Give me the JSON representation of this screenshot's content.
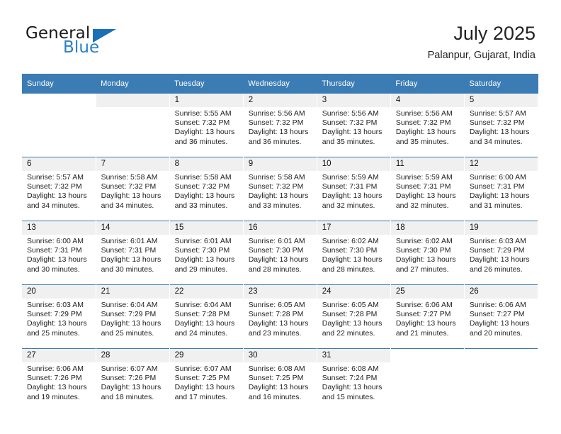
{
  "brand": {
    "word1": "General",
    "word2": "Blue",
    "triangle_color": "#1b6fb5",
    "blue_color": "#2980c4"
  },
  "header": {
    "title": "July 2025",
    "location": "Palanpur, Gujarat, India"
  },
  "theme": {
    "header_bg": "#3b7cb5",
    "daynum_bg": "#f0f0f0",
    "rule_color": "#3b7cb5"
  },
  "weekday_headers": [
    "Sunday",
    "Monday",
    "Tuesday",
    "Wednesday",
    "Thursday",
    "Friday",
    "Saturday"
  ],
  "labels": {
    "sunrise": "Sunrise:",
    "sunset": "Sunset:",
    "daylight": "Daylight:"
  },
  "weeks": [
    [
      {
        "day": "",
        "sunrise": "",
        "sunset": "",
        "daylight": "",
        "blank": true
      },
      {
        "day": "",
        "sunrise": "",
        "sunset": "",
        "daylight": "",
        "empty": true
      },
      {
        "day": "1",
        "sunrise": "Sunrise: 5:55 AM",
        "sunset": "Sunset: 7:32 PM",
        "daylight": "Daylight: 13 hours and 36 minutes."
      },
      {
        "day": "2",
        "sunrise": "Sunrise: 5:56 AM",
        "sunset": "Sunset: 7:32 PM",
        "daylight": "Daylight: 13 hours and 36 minutes."
      },
      {
        "day": "3",
        "sunrise": "Sunrise: 5:56 AM",
        "sunset": "Sunset: 7:32 PM",
        "daylight": "Daylight: 13 hours and 35 minutes."
      },
      {
        "day": "4",
        "sunrise": "Sunrise: 5:56 AM",
        "sunset": "Sunset: 7:32 PM",
        "daylight": "Daylight: 13 hours and 35 minutes."
      },
      {
        "day": "5",
        "sunrise": "Sunrise: 5:57 AM",
        "sunset": "Sunset: 7:32 PM",
        "daylight": "Daylight: 13 hours and 34 minutes."
      }
    ],
    [
      {
        "day": "6",
        "sunrise": "Sunrise: 5:57 AM",
        "sunset": "Sunset: 7:32 PM",
        "daylight": "Daylight: 13 hours and 34 minutes."
      },
      {
        "day": "7",
        "sunrise": "Sunrise: 5:58 AM",
        "sunset": "Sunset: 7:32 PM",
        "daylight": "Daylight: 13 hours and 34 minutes."
      },
      {
        "day": "8",
        "sunrise": "Sunrise: 5:58 AM",
        "sunset": "Sunset: 7:32 PM",
        "daylight": "Daylight: 13 hours and 33 minutes."
      },
      {
        "day": "9",
        "sunrise": "Sunrise: 5:58 AM",
        "sunset": "Sunset: 7:32 PM",
        "daylight": "Daylight: 13 hours and 33 minutes."
      },
      {
        "day": "10",
        "sunrise": "Sunrise: 5:59 AM",
        "sunset": "Sunset: 7:31 PM",
        "daylight": "Daylight: 13 hours and 32 minutes."
      },
      {
        "day": "11",
        "sunrise": "Sunrise: 5:59 AM",
        "sunset": "Sunset: 7:31 PM",
        "daylight": "Daylight: 13 hours and 32 minutes."
      },
      {
        "day": "12",
        "sunrise": "Sunrise: 6:00 AM",
        "sunset": "Sunset: 7:31 PM",
        "daylight": "Daylight: 13 hours and 31 minutes."
      }
    ],
    [
      {
        "day": "13",
        "sunrise": "Sunrise: 6:00 AM",
        "sunset": "Sunset: 7:31 PM",
        "daylight": "Daylight: 13 hours and 30 minutes."
      },
      {
        "day": "14",
        "sunrise": "Sunrise: 6:01 AM",
        "sunset": "Sunset: 7:31 PM",
        "daylight": "Daylight: 13 hours and 30 minutes."
      },
      {
        "day": "15",
        "sunrise": "Sunrise: 6:01 AM",
        "sunset": "Sunset: 7:30 PM",
        "daylight": "Daylight: 13 hours and 29 minutes."
      },
      {
        "day": "16",
        "sunrise": "Sunrise: 6:01 AM",
        "sunset": "Sunset: 7:30 PM",
        "daylight": "Daylight: 13 hours and 28 minutes."
      },
      {
        "day": "17",
        "sunrise": "Sunrise: 6:02 AM",
        "sunset": "Sunset: 7:30 PM",
        "daylight": "Daylight: 13 hours and 28 minutes."
      },
      {
        "day": "18",
        "sunrise": "Sunrise: 6:02 AM",
        "sunset": "Sunset: 7:30 PM",
        "daylight": "Daylight: 13 hours and 27 minutes."
      },
      {
        "day": "19",
        "sunrise": "Sunrise: 6:03 AM",
        "sunset": "Sunset: 7:29 PM",
        "daylight": "Daylight: 13 hours and 26 minutes."
      }
    ],
    [
      {
        "day": "20",
        "sunrise": "Sunrise: 6:03 AM",
        "sunset": "Sunset: 7:29 PM",
        "daylight": "Daylight: 13 hours and 25 minutes."
      },
      {
        "day": "21",
        "sunrise": "Sunrise: 6:04 AM",
        "sunset": "Sunset: 7:29 PM",
        "daylight": "Daylight: 13 hours and 25 minutes."
      },
      {
        "day": "22",
        "sunrise": "Sunrise: 6:04 AM",
        "sunset": "Sunset: 7:28 PM",
        "daylight": "Daylight: 13 hours and 24 minutes."
      },
      {
        "day": "23",
        "sunrise": "Sunrise: 6:05 AM",
        "sunset": "Sunset: 7:28 PM",
        "daylight": "Daylight: 13 hours and 23 minutes."
      },
      {
        "day": "24",
        "sunrise": "Sunrise: 6:05 AM",
        "sunset": "Sunset: 7:28 PM",
        "daylight": "Daylight: 13 hours and 22 minutes."
      },
      {
        "day": "25",
        "sunrise": "Sunrise: 6:06 AM",
        "sunset": "Sunset: 7:27 PM",
        "daylight": "Daylight: 13 hours and 21 minutes."
      },
      {
        "day": "26",
        "sunrise": "Sunrise: 6:06 AM",
        "sunset": "Sunset: 7:27 PM",
        "daylight": "Daylight: 13 hours and 20 minutes."
      }
    ],
    [
      {
        "day": "27",
        "sunrise": "Sunrise: 6:06 AM",
        "sunset": "Sunset: 7:26 PM",
        "daylight": "Daylight: 13 hours and 19 minutes."
      },
      {
        "day": "28",
        "sunrise": "Sunrise: 6:07 AM",
        "sunset": "Sunset: 7:26 PM",
        "daylight": "Daylight: 13 hours and 18 minutes."
      },
      {
        "day": "29",
        "sunrise": "Sunrise: 6:07 AM",
        "sunset": "Sunset: 7:25 PM",
        "daylight": "Daylight: 13 hours and 17 minutes."
      },
      {
        "day": "30",
        "sunrise": "Sunrise: 6:08 AM",
        "sunset": "Sunset: 7:25 PM",
        "daylight": "Daylight: 13 hours and 16 minutes."
      },
      {
        "day": "31",
        "sunrise": "Sunrise: 6:08 AM",
        "sunset": "Sunset: 7:24 PM",
        "daylight": "Daylight: 13 hours and 15 minutes."
      },
      {
        "day": "",
        "sunrise": "",
        "sunset": "",
        "daylight": "",
        "blank": true
      },
      {
        "day": "",
        "sunrise": "",
        "sunset": "",
        "daylight": "",
        "blank": true
      }
    ]
  ]
}
